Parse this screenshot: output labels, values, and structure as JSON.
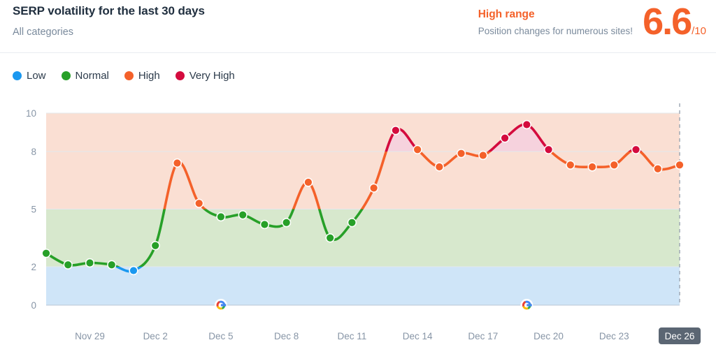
{
  "header": {
    "title": "SERP volatility for the last 30 days",
    "subtitle": "All categories",
    "range_title": "High range",
    "range_description": "Position changes for numerous sites!",
    "score_value": "6.6",
    "score_denominator": "/10",
    "accent_color": "#f4612a"
  },
  "legend": {
    "items": [
      {
        "label": "Low",
        "color": "#1a98f0"
      },
      {
        "label": "Normal",
        "color": "#27a028"
      },
      {
        "label": "High",
        "color": "#f4612a"
      },
      {
        "label": "Very High",
        "color": "#d40b3e"
      }
    ]
  },
  "chart_data": {
    "type": "line",
    "title": "SERP volatility for the last 30 days",
    "xlabel": "",
    "ylabel": "",
    "ylim": [
      0,
      10
    ],
    "yticks": [
      0,
      2,
      5,
      8,
      10
    ],
    "grid": true,
    "legend_position": "top-left",
    "x": [
      "Nov 27",
      "Nov 28",
      "Nov 29",
      "Nov 30",
      "Dec 1",
      "Dec 2",
      "Dec 3",
      "Dec 4",
      "Dec 5",
      "Dec 6",
      "Dec 7",
      "Dec 8",
      "Dec 9",
      "Dec 10",
      "Dec 11",
      "Dec 12",
      "Dec 13",
      "Dec 14",
      "Dec 15",
      "Dec 16",
      "Dec 17",
      "Dec 18",
      "Dec 19",
      "Dec 20",
      "Dec 21",
      "Dec 22",
      "Dec 23",
      "Dec 24",
      "Dec 25",
      "Dec 26"
    ],
    "values": [
      2.7,
      2.1,
      2.2,
      2.1,
      1.8,
      3.1,
      7.4,
      5.3,
      4.6,
      4.7,
      4.2,
      4.3,
      6.4,
      3.5,
      4.3,
      6.1,
      9.1,
      8.1,
      7.2,
      7.9,
      7.8,
      8.7,
      9.4,
      8.1,
      7.3,
      7.2,
      7.3,
      8.1,
      7.1,
      7.3
    ],
    "point_levels": [
      "normal",
      "normal",
      "normal",
      "normal",
      "low",
      "normal",
      "high",
      "high",
      "normal",
      "normal",
      "normal",
      "normal",
      "high",
      "normal",
      "normal",
      "high",
      "veryhigh",
      "high",
      "high",
      "high",
      "high",
      "veryhigh",
      "veryhigh",
      "veryhigh",
      "high",
      "high",
      "high",
      "veryhigh",
      "high",
      "high"
    ],
    "xticks": [
      "Nov 29",
      "Dec 2",
      "Dec 5",
      "Dec 8",
      "Dec 11",
      "Dec 14",
      "Dec 17",
      "Dec 20",
      "Dec 23",
      "Dec 26"
    ],
    "today_label": "Dec 26",
    "bands": [
      {
        "name": "Low",
        "from": 0,
        "to": 2,
        "color": "#cfe5f8"
      },
      {
        "name": "Normal",
        "from": 2,
        "to": 5,
        "color": "#d7e8cd"
      },
      {
        "name": "High",
        "from": 5,
        "to": 10,
        "color": "#fadfd3"
      }
    ],
    "band_very_high_fill": "#f6d2dd",
    "annotations": [
      {
        "type": "google-update-marker",
        "x": "Dec 5"
      },
      {
        "type": "google-update-marker",
        "x": "Dec 19"
      },
      {
        "type": "today-line",
        "x": "Dec 26"
      }
    ]
  }
}
